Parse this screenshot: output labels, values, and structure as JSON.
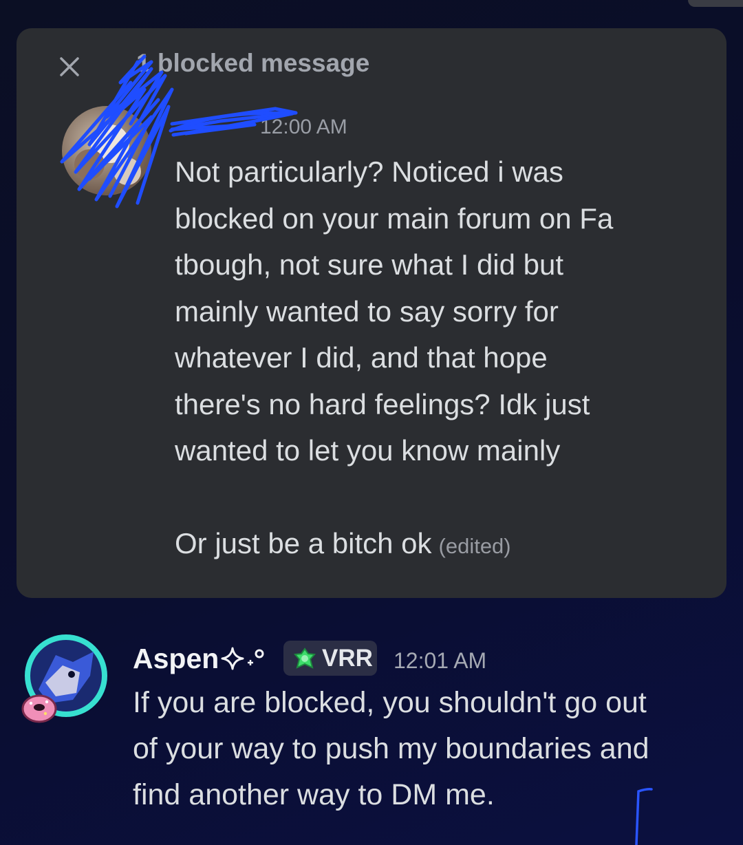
{
  "blocked_card": {
    "label": "1 blocked message",
    "close_icon": "close-icon",
    "message": {
      "timestamp": "12:00 AM",
      "lines": [
        "Not particularly? Noticed i was",
        "blocked on your main forum on Fa",
        "tbough, not sure what I did but",
        "mainly wanted to say sorry for",
        "whatever I did, and that hope",
        "there's no hard feelings? Idk just",
        "wanted to let you know mainly"
      ],
      "last_line": "Or just be a bitch ok",
      "edited_label": "(edited)"
    }
  },
  "reply": {
    "username": "Aspen",
    "username_suffix": "✧₊°",
    "tag": {
      "label": "VRR",
      "icon": "gem-icon"
    },
    "timestamp": "12:01 AM",
    "lines": [
      "If you are blocked, you shouldn't go out",
      "of your way to push my boundaries and",
      "find another way to DM me."
    ]
  },
  "colors": {
    "background": "#0a0d2b",
    "card": "#2b2d31",
    "text": "#dbdee1",
    "muted": "#9a9ea6",
    "scribble": "#1f4dff",
    "tag_bg": "#2b2e45",
    "gem": "#3ddc6b"
  }
}
